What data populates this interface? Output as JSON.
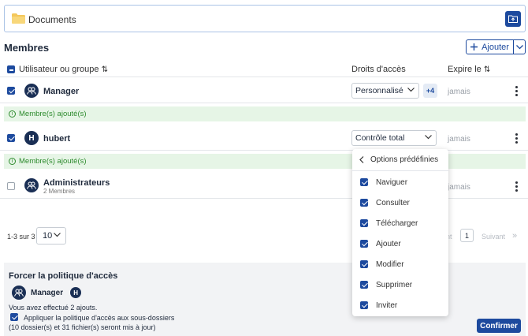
{
  "folder": {
    "name": "Documents",
    "icon": "folder-icon",
    "action_icon": "folder-upload-icon"
  },
  "members": {
    "title": "Membres",
    "add_label": "Ajouter",
    "columns": {
      "user": "Utilisateur ou groupe",
      "rights": "Droits d'accès",
      "expires": "Expire le"
    },
    "rows": [
      {
        "name": "Manager",
        "subtitle": "",
        "avatar_letter": "",
        "rights": "Personnalisé",
        "extra": "+4",
        "expires": "jamais",
        "notice": "Membre(s) ajouté(s)",
        "checked": true
      },
      {
        "name": "hubert",
        "subtitle": "",
        "avatar_letter": "H",
        "rights": "Contrôle total",
        "extra": "",
        "expires": "jamais",
        "notice": "Membre(s) ajouté(s)",
        "checked": true
      },
      {
        "name": "Administrateurs",
        "subtitle": "2 Membres",
        "avatar_letter": "",
        "rights": "",
        "extra": "",
        "expires": "jamais",
        "notice": "",
        "checked": false
      }
    ]
  },
  "pagination": {
    "range": "1-3 sur 3",
    "per_page": "10",
    "prev_fragment": "nt",
    "page": "1",
    "next": "Suivant",
    "last": "»"
  },
  "dropdown": {
    "title": "Options prédéfinies",
    "items": [
      "Naviguer",
      "Consulter",
      "Télécharger",
      "Ajouter",
      "Modifier",
      "Supprimer",
      "Inviter"
    ]
  },
  "policy": {
    "title": "Forcer la politique d'accès",
    "member_name": "Manager",
    "second_avatar": "H",
    "summary": "Vous avez effectué 2 ajouts.",
    "checkbox_label": "Appliquer la politique d'accès aux sous-dossiers",
    "details": "(10 dossier(s) et 31 fichier(s) seront mis à jour)",
    "confirm": "Confirmer"
  },
  "colors": {
    "primary": "#1d4a9e",
    "success": "#2e8b2e",
    "notice_bg": "#e6f5e6"
  }
}
